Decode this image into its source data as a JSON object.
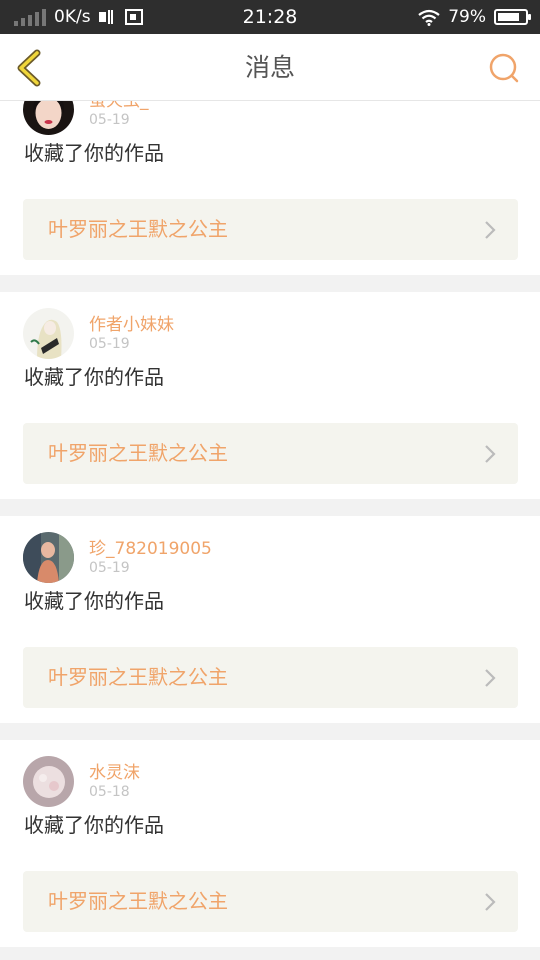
{
  "status_bar": {
    "net_speed": "0K/s",
    "time": "21:28",
    "battery_percent": "79%",
    "battery_level": 0.79,
    "icons": [
      "signal-icon",
      "vibrate-icon",
      "screenshot-icon",
      "wifi-icon",
      "battery-icon"
    ]
  },
  "header": {
    "title": "消息",
    "back_icon": "chevron-left-icon",
    "search_icon": "search-icon",
    "accent_color": "#f0a46a"
  },
  "messages": [
    {
      "username": "萤火虫_",
      "date": "05-19",
      "action": "收藏了你的作品",
      "work_title": "叶罗丽之王默之公主"
    },
    {
      "username": "作者小妹妹",
      "date": "05-19",
      "action": "收藏了你的作品",
      "work_title": "叶罗丽之王默之公主"
    },
    {
      "username": "珍_782019005",
      "date": "05-19",
      "action": "收藏了你的作品",
      "work_title": "叶罗丽之王默之公主"
    },
    {
      "username": "水灵沫",
      "date": "05-18",
      "action": "收藏了你的作品",
      "work_title": "叶罗丽之王默之公主"
    }
  ]
}
